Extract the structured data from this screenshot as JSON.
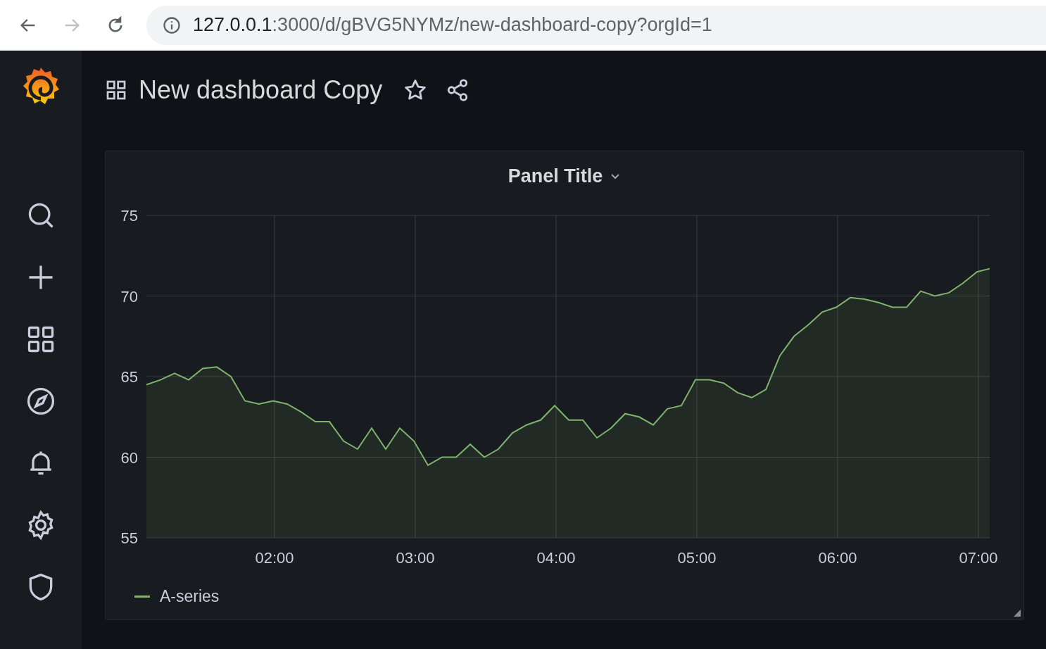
{
  "browser": {
    "url_host": "127.0.0.1",
    "url_rest": ":3000/d/gBVG5NYMz/new-dashboard-copy?orgId=1"
  },
  "sidebar": {
    "items": [
      {
        "kind": "search"
      },
      {
        "kind": "plus"
      },
      {
        "kind": "grid"
      },
      {
        "kind": "compass"
      },
      {
        "kind": "bell"
      },
      {
        "kind": "gear"
      },
      {
        "kind": "shield"
      }
    ]
  },
  "dashboard": {
    "title": "New dashboard Copy"
  },
  "panel": {
    "title": "Panel Title",
    "chart_data": {
      "type": "area",
      "grid": true,
      "xlim": [
        1.09,
        7.08
      ],
      "ylim": [
        55,
        75
      ],
      "xticks": [
        {
          "value": 2,
          "label": "02:00"
        },
        {
          "value": 3,
          "label": "03:00"
        },
        {
          "value": 4,
          "label": "04:00"
        },
        {
          "value": 5,
          "label": "05:00"
        },
        {
          "value": 6,
          "label": "06:00"
        },
        {
          "value": 7,
          "label": "07:00"
        }
      ],
      "yticks": [
        55,
        60,
        65,
        70,
        75
      ],
      "x": [
        1.09,
        1.19,
        1.29,
        1.39,
        1.49,
        1.59,
        1.69,
        1.79,
        1.89,
        1.99,
        2.09,
        2.19,
        2.29,
        2.39,
        2.49,
        2.59,
        2.69,
        2.79,
        2.89,
        2.99,
        3.09,
        3.19,
        3.29,
        3.39,
        3.49,
        3.59,
        3.69,
        3.79,
        3.89,
        3.99,
        4.09,
        4.19,
        4.29,
        4.39,
        4.49,
        4.59,
        4.69,
        4.79,
        4.89,
        4.99,
        5.09,
        5.19,
        5.29,
        5.39,
        5.49,
        5.59,
        5.69,
        5.79,
        5.89,
        5.99,
        6.09,
        6.19,
        6.29,
        6.39,
        6.49,
        6.59,
        6.69,
        6.79,
        6.89,
        6.99,
        7.08
      ],
      "series": [
        {
          "name": "A-series",
          "color": "#7eb26d",
          "values": [
            64.5,
            64.8,
            65.2,
            64.8,
            65.5,
            65.6,
            65,
            63.5,
            63.3,
            63.5,
            63.3,
            62.8,
            62.2,
            62.2,
            61,
            60.5,
            61.8,
            60.5,
            61.8,
            61,
            59.5,
            60,
            60,
            60.8,
            60,
            60.5,
            61.5,
            62,
            62.3,
            63.2,
            62.3,
            62.3,
            61.2,
            61.8,
            62.7,
            62.5,
            62,
            63,
            63.2,
            64.8,
            64.8,
            64.6,
            64,
            63.7,
            64.2,
            66.3,
            67.5,
            68.2,
            69,
            69.3,
            69.9,
            69.8,
            69.6,
            69.3,
            69.3,
            70.3,
            70,
            70.2,
            70.8,
            71.5,
            71.7
          ]
        }
      ]
    }
  }
}
